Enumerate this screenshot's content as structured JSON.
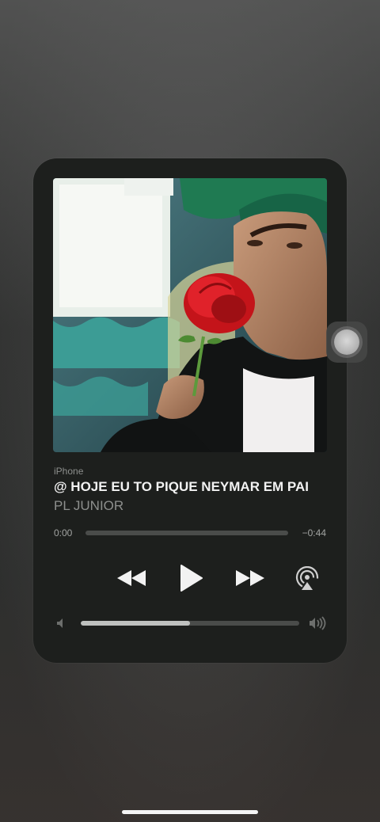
{
  "now_playing": {
    "source": "iPhone",
    "title": "@ HOJE EU TO PIQUE NEYMAR EM PAI",
    "artist": "PL JUNIOR",
    "time_elapsed": "0:00",
    "time_remaining": "−0:44",
    "progress_fraction": 0.0,
    "volume_fraction": 0.5
  },
  "icons": {
    "rewind": "rewind-icon",
    "play": "play-icon",
    "forward": "fast-forward-icon",
    "airplay": "airplay-icon",
    "volume_low": "speaker-low-icon",
    "volume_high": "speaker-high-icon",
    "assistive_touch": "assistive-touch-icon"
  },
  "colors": {
    "card_background": "#1d1f1d",
    "primary_text": "#f2f2f2",
    "secondary_text": "#8d8f8d"
  }
}
